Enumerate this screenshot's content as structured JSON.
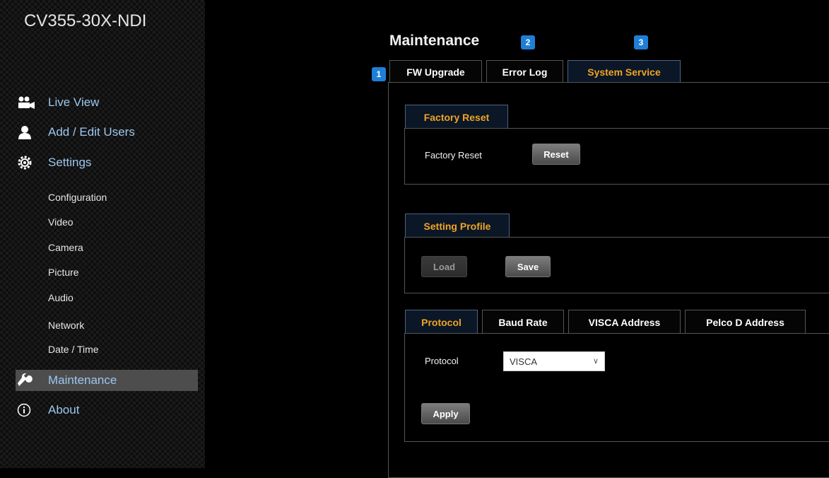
{
  "app": {
    "title": "CV355-30X-NDI"
  },
  "sidebar": {
    "items": [
      {
        "label": "Live View",
        "icon": "camera-icon"
      },
      {
        "label": "Add / Edit Users",
        "icon": "user-icon"
      },
      {
        "label": "Settings",
        "icon": "gear-icon"
      },
      {
        "label": "Maintenance",
        "icon": "wrench-icon",
        "active": true
      },
      {
        "label": "About",
        "icon": "info-icon"
      }
    ],
    "sub_items": [
      "Configuration",
      "Video",
      "Camera",
      "Picture",
      "Audio",
      "Network",
      "Date / Time"
    ]
  },
  "main": {
    "title": "Maintenance",
    "badges": [
      "1",
      "2",
      "3"
    ],
    "tabs": [
      {
        "label": "FW Upgrade"
      },
      {
        "label": "Error Log"
      },
      {
        "label": "System Service",
        "active": true
      }
    ]
  },
  "factory_reset": {
    "section_label": "Factory Reset",
    "field_label": "Factory Reset",
    "button_label": "Reset"
  },
  "setting_profile": {
    "section_label": "Setting Profile",
    "load_label": "Load",
    "save_label": "Save"
  },
  "protocol": {
    "tabs": [
      {
        "label": "Protocol",
        "active": true
      },
      {
        "label": "Baud Rate"
      },
      {
        "label": "VISCA Address"
      },
      {
        "label": "Pelco D Address"
      }
    ],
    "field_label": "Protocol",
    "selected_value": "VISCA",
    "apply_label": "Apply"
  },
  "colors": {
    "accent": "#f0a423",
    "badge": "#1f7fd6",
    "nav_link": "#9cc7ef"
  }
}
